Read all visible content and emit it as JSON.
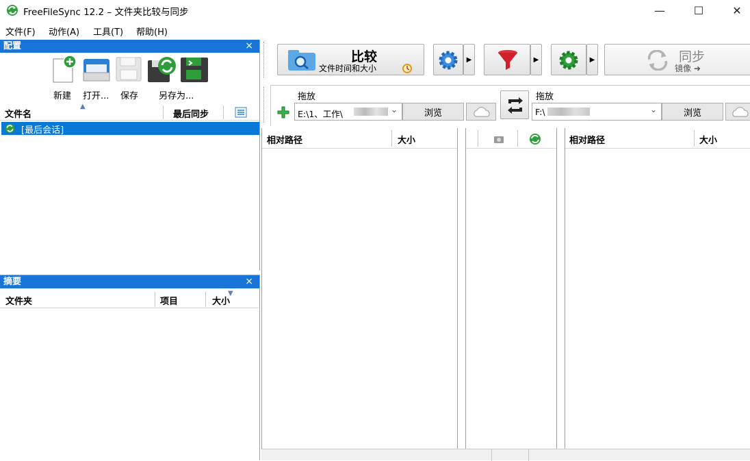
{
  "window": {
    "title": "FreeFileSync 12.2 – 文件夹比较与同步",
    "minimize": "—",
    "maximize": "☐",
    "close": "✕"
  },
  "menu": [
    "文件(F)",
    "动作(A)",
    "工具(T)",
    "帮助(H)"
  ],
  "config_panel": {
    "title": "配置",
    "close": "×",
    "toolbar": {
      "new": "新建",
      "open": "打开...",
      "save": "保存",
      "save_as": "另存为..."
    },
    "columns": {
      "name": "文件名",
      "last_sync": "最后同步"
    },
    "items": [
      {
        "label": "[最后会话]",
        "selected": true
      }
    ]
  },
  "summary_panel": {
    "title": "摘要",
    "close": "×",
    "columns": {
      "folder": "文件夹",
      "items": "项目",
      "size": "大小"
    }
  },
  "main_toolbar": {
    "compare_title": "比较",
    "compare_sub": "文件时间和大小",
    "sync_title": "同步",
    "sync_sub": "镜像 ➜"
  },
  "folder_bar": {
    "left_drop": "拖放",
    "left_path": "E:\\1、工作\\",
    "left_browse": "浏览",
    "right_drop": "拖放",
    "right_path": "F:\\",
    "right_browse": "浏览"
  },
  "grid": {
    "left_cols": {
      "path": "相对路径",
      "size": "大小"
    },
    "right_cols": {
      "path": "相对路径",
      "size": "大小"
    }
  },
  "colors": {
    "accent": "#1874d6",
    "selection": "#0a78d7",
    "green_icon": "#2e9e3a",
    "filter_red": "#d0202b"
  }
}
